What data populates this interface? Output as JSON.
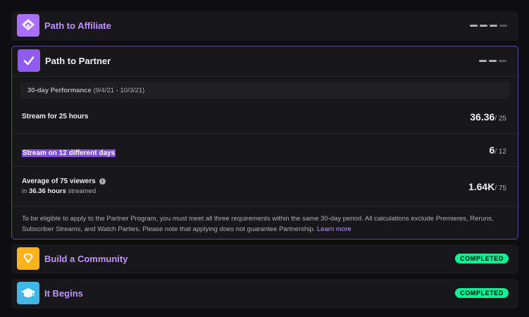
{
  "affiliate": {
    "title": "Path to Affiliate",
    "icon": "chevron-up-diamond-icon",
    "icon_bg": "#a970ff"
  },
  "partner": {
    "title": "Path to Partner",
    "icon": "check-icon",
    "icon_bg": "#8e5cf2",
    "performance_label": "30-day Performance",
    "performance_range": "(9/4/21 - 10/3/21)",
    "metrics": [
      {
        "label": "Stream for 25 hours",
        "value": "36.36",
        "target": "/ 25"
      },
      {
        "label": "Stream on 12 different days",
        "value": "6",
        "target": "/ 12"
      },
      {
        "label": "Average of 75 viewers",
        "sub_prefix": "in",
        "sub_value": "36.36 hours",
        "sub_suffix": "streamed",
        "value": "1.64K",
        "target": "/ 75"
      }
    ],
    "note": "To be eligible to apply to the Partner Program, you must meet all three requirements within the same 30-day period. All calculations exclude Premieres, Reruns, Subscriber Streams, and Watch Parties. Please note that applying does not guarantee Partnership.",
    "learn_more": "Learn more"
  },
  "community": {
    "title": "Build a Community",
    "icon": "diamond-gem-icon",
    "icon_bg": "#ffb31a",
    "status": "COMPLETED"
  },
  "begins": {
    "title": "It Begins",
    "icon": "graduation-cap-icon",
    "icon_bg": "#41b7e8",
    "status": "COMPLETED"
  },
  "colors": {
    "accent": "#bf94ff",
    "completed": "#00f593",
    "highlight": "#7d4bd8"
  }
}
